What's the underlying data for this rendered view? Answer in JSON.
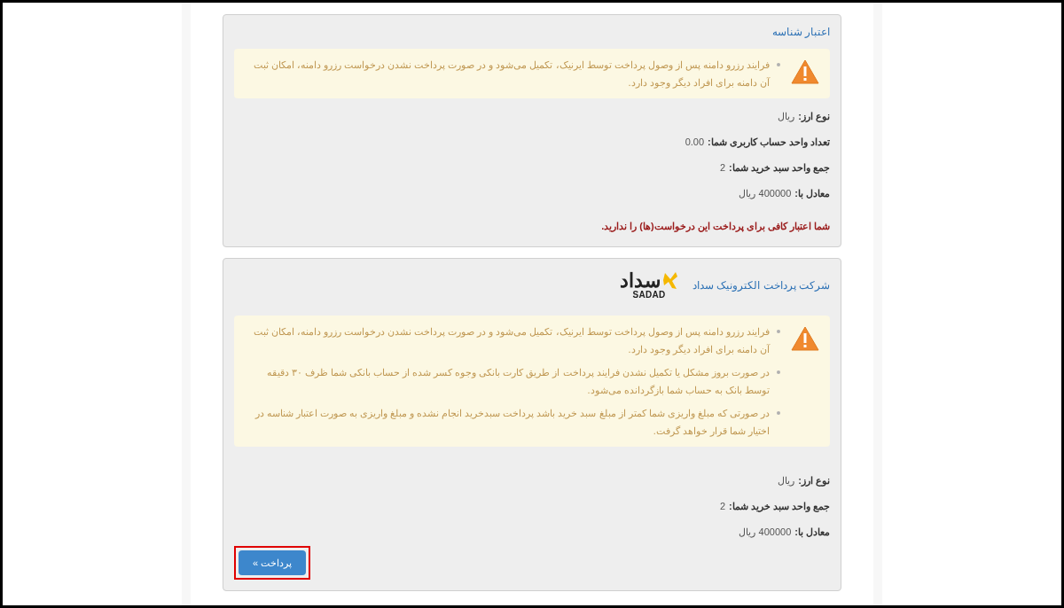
{
  "cards": [
    {
      "title": "اعتبار شناسه",
      "notices": [
        "فرایند رزرو دامنه پس از وصول پرداخت توسط ایرنیک، تکمیل می‌شود و در صورت پرداخت نشدن درخواست رزرو دامنه، امکان ثبت آن دامنه برای افراد دیگر وجود دارد."
      ],
      "fields": [
        {
          "label": "نوع ارز:",
          "value": "ریال"
        },
        {
          "label": "تعداد واحد حساب کاربری شما:",
          "value": "0.00"
        },
        {
          "label": "جمع واحد سبد خرید شما:",
          "value": "2"
        },
        {
          "label": "معادل با:",
          "value": "400000 ریال"
        }
      ],
      "error": "شما اعتبار کافی برای پرداخت این درخواست(ها) را ندارید."
    },
    {
      "title": "شرکت پرداخت الکترونیک سداد",
      "logo": {
        "word": "سداد",
        "latin": "SADAD"
      },
      "notices": [
        "فرایند رزرو دامنه پس از وصول پرداخت توسط ایرنیک، تکمیل می‌شود و در صورت پرداخت نشدن درخواست رزرو دامنه، امکان ثبت آن دامنه برای افراد دیگر وجود دارد.",
        "در صورت بروز مشکل یا تکمیل نشدن فرایند پرداخت از طریق کارت بانکی وجوه کسر شده از حساب بانکی شما ظرف ۳۰ دقیقه توسط بانک به حساب شما بازگردانده می‌شود.",
        "در صورتی که مبلغ واریزی شما کمتر از مبلغ سبد خرید باشد پرداخت سبدخرید انجام نشده و مبلغ واریزی به صورت اعتبار شناسه در اختیار شما قرار خواهد گرفت."
      ],
      "fields": [
        {
          "label": "نوع ارز:",
          "value": "ریال"
        },
        {
          "label": "جمع واحد سبد خرید شما:",
          "value": "2"
        },
        {
          "label": "معادل با:",
          "value": "400000 ریال"
        }
      ],
      "button": {
        "label": "پرداخت »",
        "highlighted": true
      }
    }
  ]
}
